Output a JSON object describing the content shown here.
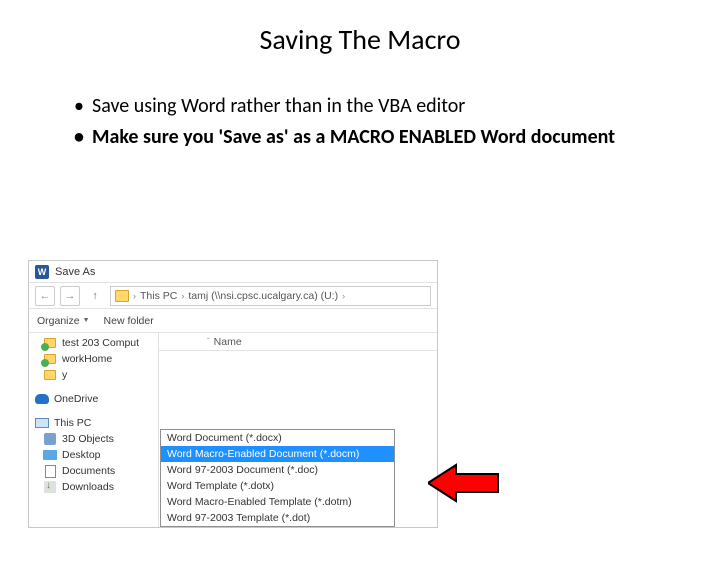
{
  "title": "Saving The Macro",
  "bullets": [
    "Save using Word rather than in the VBA editor",
    "Make sure you 'Save as' as a MACRO ENABLED Word document"
  ],
  "dialog": {
    "window_title": "Save As",
    "path_segments": [
      "This PC",
      "tamj (\\\\nsi.cpsc.ucalgary.ca) (U:)"
    ],
    "toolbar": {
      "organize": "Organize",
      "new_folder": "New folder"
    },
    "column_header": "Name",
    "sidebar": {
      "quick": [
        "test 203 Comput",
        "workHome",
        "y"
      ],
      "onedrive": "OneDrive",
      "thispc": "This PC",
      "thispc_children": [
        "3D Objects",
        "Desktop",
        "Documents",
        "Downloads"
      ]
    },
    "filetypes": [
      "Word Document (*.docx)",
      "Word Macro-Enabled Document (*.docm)",
      "Word 97-2003 Document (*.doc)",
      "Word Template (*.dotx)",
      "Word Macro-Enabled Template (*.dotm)",
      "Word 97-2003 Template (*.dot)"
    ],
    "selected_filetype_index": 1
  }
}
